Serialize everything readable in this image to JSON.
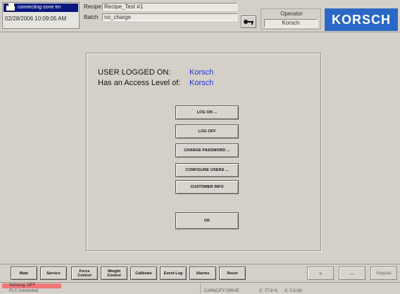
{
  "header": {
    "logo_text": "connecting-zone tm",
    "datetime": "02/28/2006 10:09:05 AM",
    "recipe_label": "Recipe",
    "recipe_value": "Recipe_Test #1",
    "batch_label": "Batch",
    "batch_value": "no_charge",
    "operator_title": "Operator",
    "operator_name": "Korsch",
    "brand": "KORSCH"
  },
  "login": {
    "user_label": "USER LOGGED ON:",
    "user_value": "Korsch",
    "access_label": "Has an Access Level of:",
    "access_value": "Korsch",
    "buttons": {
      "log_on": "LOG ON ...",
      "log_off": "LOG OFF",
      "change_password": "CHANGE PASSWORD ...",
      "configure_users": "CONFIGURE USERS ...",
      "customer_info": "CUSTOMER INFO",
      "ok": "OK"
    }
  },
  "nav": {
    "main": "Main",
    "service": "Service",
    "force_control_1": "Force",
    "force_control_2": "Control",
    "weight_control_1": "Weight",
    "weight_control_2": "Control",
    "calibrate": "Calibrate",
    "event_log": "Event Log",
    "alarms": "Alarms",
    "reset": "Reset",
    "plus": "+",
    "minus": "–",
    "keypad": "Keypad"
  },
  "status": {
    "alarm": "Achtung: OFF",
    "plc": "PLC connected",
    "capacity": "CAPACITY DRIVE",
    "value_c": "C: 77.9 %",
    "value_x": "X: 0.3 kN"
  },
  "colors": {
    "brand_bg": "#2b67c4",
    "value_text": "#1e32d8",
    "alarm_bg": "#f07878",
    "logo_bar": "#0b1880"
  }
}
